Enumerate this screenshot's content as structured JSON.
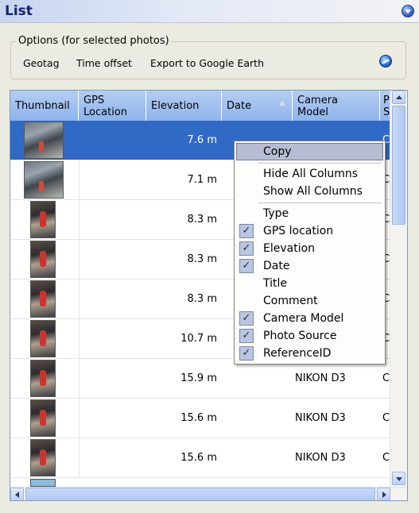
{
  "panel": {
    "title": "List"
  },
  "options": {
    "legend": "Options (for selected photos)",
    "actions": [
      "Geotag",
      "Time offset",
      "Export to Google Earth"
    ]
  },
  "grid": {
    "columns": [
      {
        "label": "Thumbnail"
      },
      {
        "label": "GPS Location"
      },
      {
        "label": "Elevation"
      },
      {
        "label": "Date"
      },
      {
        "label": "Camera Model"
      },
      {
        "label": "P S"
      }
    ],
    "rows": [
      {
        "elevation": "7.6 m",
        "camera": "",
        "extra": "C:"
      },
      {
        "elevation": "7.1 m",
        "camera": "",
        "extra": "C:"
      },
      {
        "elevation": "8.3 m",
        "camera": "",
        "extra": "C:"
      },
      {
        "elevation": "8.3 m",
        "camera": "",
        "extra": "C:"
      },
      {
        "elevation": "8.3 m",
        "camera": "",
        "extra": "C:"
      },
      {
        "elevation": "10.7 m",
        "camera": "",
        "extra": "C:"
      },
      {
        "elevation": "15.9 m",
        "camera": "NIKON D3",
        "extra": "C:"
      },
      {
        "elevation": "15.6 m",
        "camera": "NIKON D3",
        "extra": "C:"
      },
      {
        "elevation": "15.6 m",
        "camera": "NIKON D3",
        "extra": "C:"
      }
    ]
  },
  "context_menu": {
    "items": [
      {
        "label": "Copy",
        "checked": false,
        "highlighted": true
      },
      {
        "label": "Hide All Columns",
        "checked": false
      },
      {
        "label": "Show All Columns",
        "checked": false
      },
      {
        "label": "Type",
        "checked": false
      },
      {
        "label": "GPS location",
        "checked": true
      },
      {
        "label": "Elevation",
        "checked": true
      },
      {
        "label": "Date",
        "checked": true
      },
      {
        "label": "Title",
        "checked": false
      },
      {
        "label": "Comment",
        "checked": false
      },
      {
        "label": "Camera Model",
        "checked": true
      },
      {
        "label": "Photo Source",
        "checked": true
      },
      {
        "label": "ReferenceID",
        "checked": true
      }
    ],
    "check_mark": "✓"
  },
  "colors": {
    "header_blue": "#a6c2ef",
    "selection": "#316ac5",
    "menu_highlight": "#b6bdd2"
  }
}
